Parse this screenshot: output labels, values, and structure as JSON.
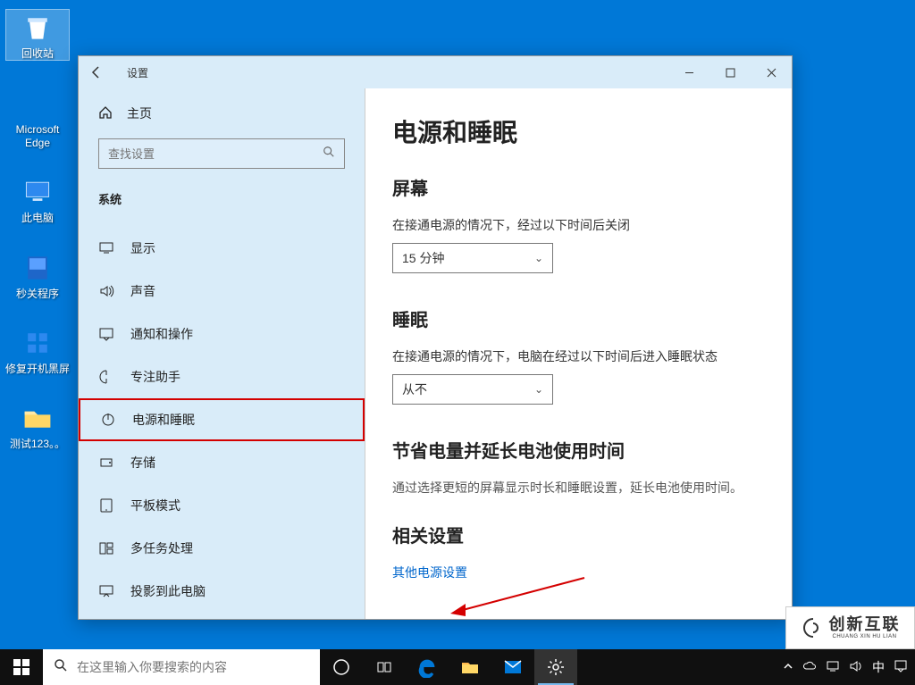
{
  "desktop": {
    "icons": [
      {
        "label": "回收站"
      },
      {
        "label": "Microsoft\nEdge"
      },
      {
        "label": "此电脑"
      },
      {
        "label": "秒关程序"
      },
      {
        "label": "修复开机黑屏"
      },
      {
        "label": "测试123。。"
      }
    ]
  },
  "settings": {
    "titlebar": {
      "title": "设置"
    },
    "home_label": "主页",
    "search_placeholder": "查找设置",
    "section_label": "系统",
    "nav_items": [
      {
        "label": "显示"
      },
      {
        "label": "声音"
      },
      {
        "label": "通知和操作"
      },
      {
        "label": "专注助手"
      },
      {
        "label": "电源和睡眠"
      },
      {
        "label": "存储"
      },
      {
        "label": "平板模式"
      },
      {
        "label": "多任务处理"
      },
      {
        "label": "投影到此电脑"
      }
    ],
    "main": {
      "title": "电源和睡眠",
      "screen_heading": "屏幕",
      "screen_desc": "在接通电源的情况下，经过以下时间后关闭",
      "screen_value": "15 分钟",
      "sleep_heading": "睡眠",
      "sleep_desc": "在接通电源的情况下，电脑在经过以下时间后进入睡眠状态",
      "sleep_value": "从不",
      "battery_heading": "节省电量并延长电池使用时间",
      "battery_tip": "通过选择更短的屏幕显示时长和睡眠设置，延长电池使用时间。",
      "related_heading": "相关设置",
      "related_link": "其他电源设置"
    }
  },
  "taskbar": {
    "search_placeholder": "在这里输入你要搜索的内容",
    "ime": "中"
  },
  "watermark": {
    "brand": "创新互联",
    "sub": "CHUANG XIN HU LIAN"
  }
}
